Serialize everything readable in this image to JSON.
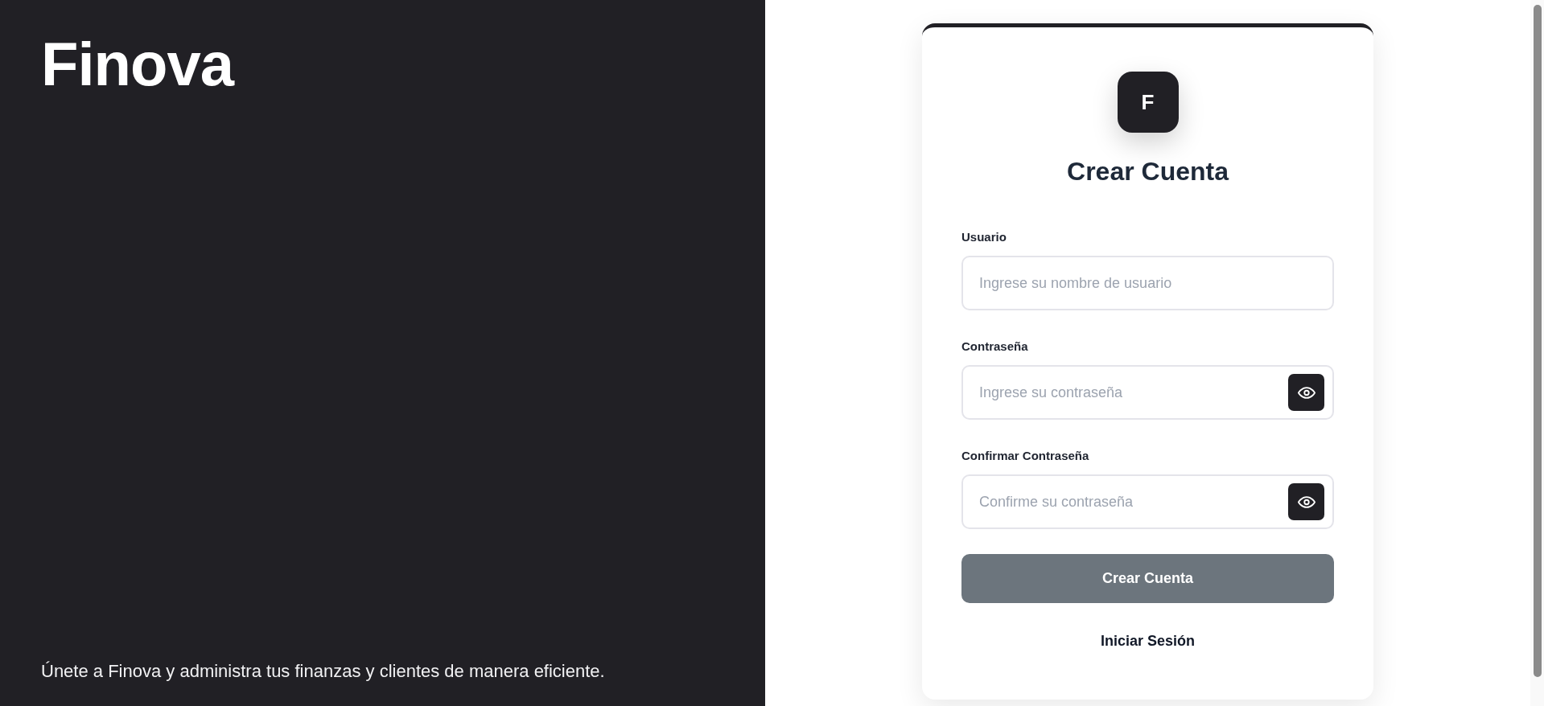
{
  "brand_panel": {
    "title": "Finova",
    "tagline": "Únete a Finova y administra tus finanzas y clientes de manera eficiente."
  },
  "card": {
    "logo_letter": "F",
    "heading": "Crear Cuenta",
    "fields": [
      {
        "kind": "text",
        "label": "Usuario",
        "placeholder": "Ingrese su nombre de usuario"
      },
      {
        "kind": "password",
        "label": "Contraseña",
        "placeholder": "Ingrese su contraseña"
      },
      {
        "kind": "password",
        "label": "Confirmar Contraseña",
        "placeholder": "Confirme su contraseña"
      }
    ],
    "submit_button": {
      "label": "Crear Cuenta",
      "disabled": true
    },
    "login_link": "Iniciar Sesión"
  }
}
